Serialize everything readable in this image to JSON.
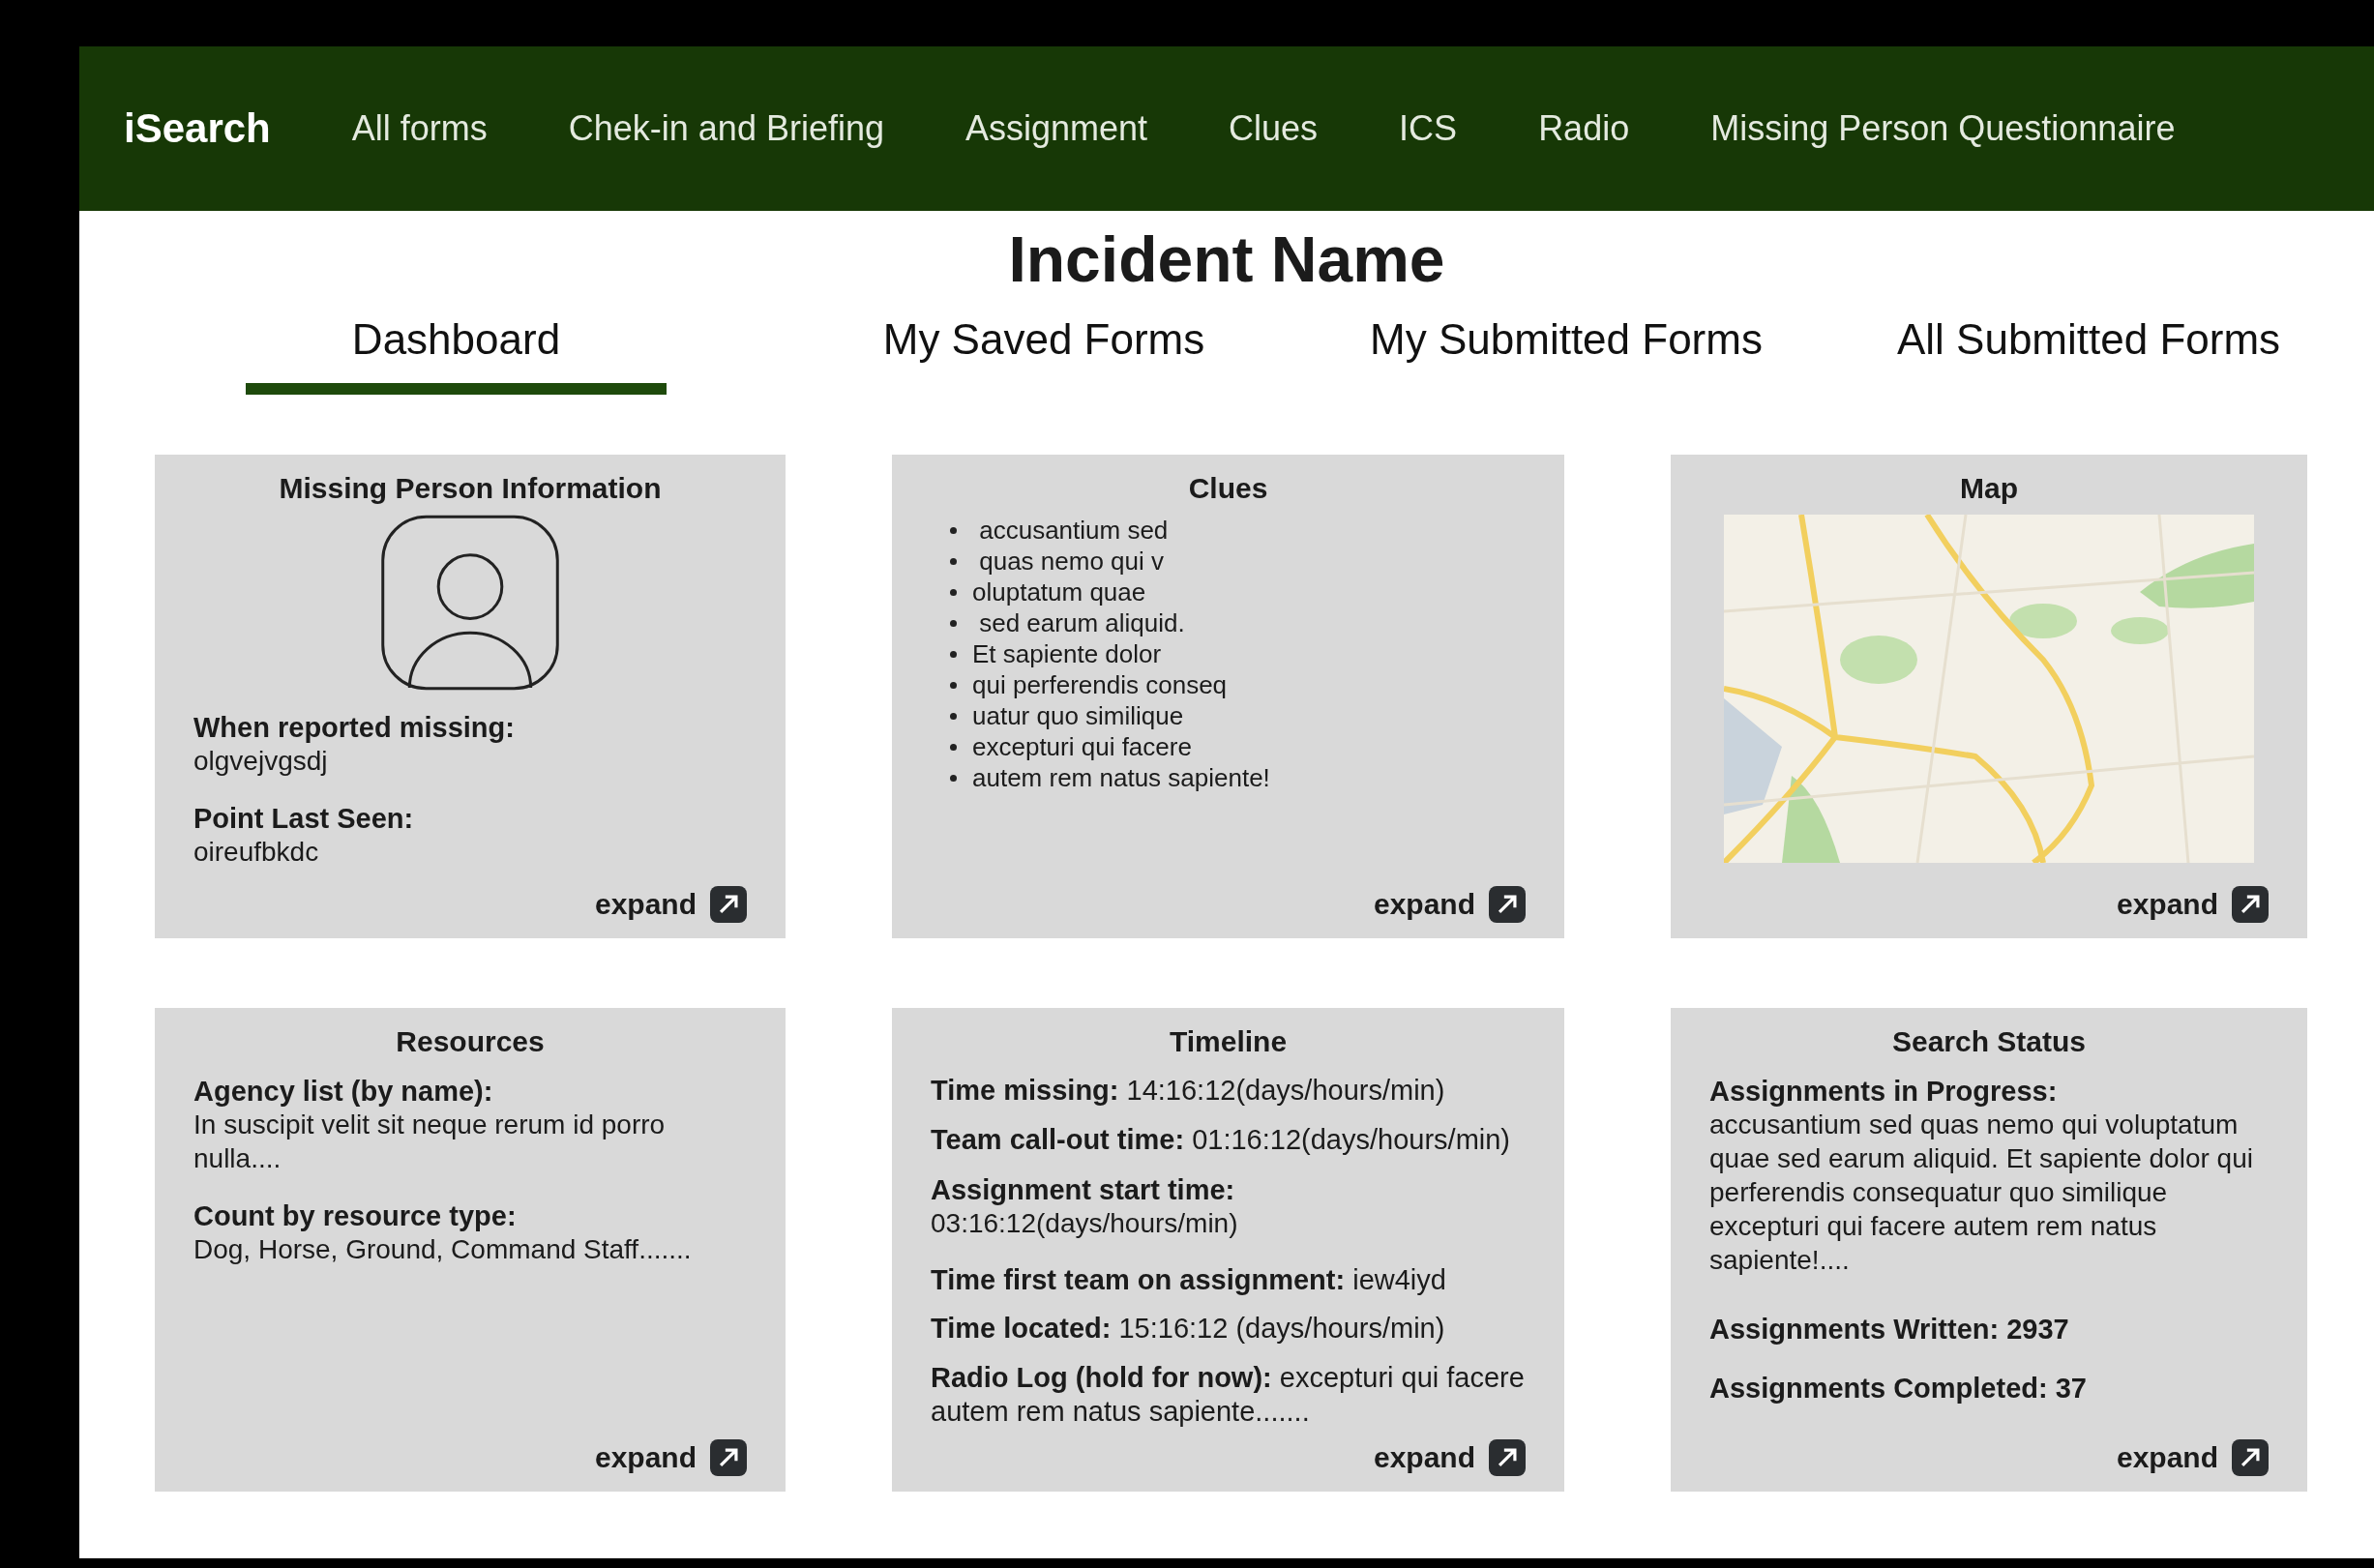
{
  "nav": {
    "brand": "iSearch",
    "items": [
      {
        "label": "All forms"
      },
      {
        "label": "Chek-in and Briefing"
      },
      {
        "label": "Assignment"
      },
      {
        "label": "Clues"
      },
      {
        "label": "ICS"
      },
      {
        "label": "Radio"
      },
      {
        "label": "Missing Person Questionnaire"
      }
    ]
  },
  "title": "Incident Name",
  "tabs": [
    {
      "label": "Dashboard",
      "selected": true
    },
    {
      "label": "My Saved Forms",
      "selected": false
    },
    {
      "label": "My Submitted Forms",
      "selected": false
    },
    {
      "label": "All Submitted Forms",
      "selected": false
    }
  ],
  "cards": [
    {
      "title": "Missing Person Information",
      "expand": "expand",
      "blocks": [
        {
          "kind": "avatar"
        },
        {
          "kind": "stacked",
          "label": "When reported missing:",
          "value": "olgvejvgsdj"
        },
        {
          "kind": "stacked",
          "label": "Point Last Seen:",
          "value": "oireufbkdc"
        }
      ]
    },
    {
      "title": "Clues",
      "expand": "expand",
      "blocks": [
        {
          "kind": "bullets",
          "items": [
            " accusantium sed",
            " quas nemo qui v",
            "oluptatum quae",
            " sed earum aliquid.",
            "Et sapiente dolor",
            "qui perferendis conseq",
            "uatur quo similique",
            "excepturi qui facere",
            "autem rem natus sapiente!"
          ]
        }
      ]
    },
    {
      "title": "Map",
      "expand": "expand"
    },
    {
      "title": "Resources",
      "expand": "expand",
      "blocks": [
        {
          "kind": "stacked",
          "label": "Agency list (by name):",
          "value": "In suscipit velit sit neque rerum id porro nulla...."
        },
        {
          "kind": "stacked",
          "label": "Count by resource type:",
          "value": "Dog, Horse, Ground, Command Staff......."
        }
      ]
    },
    {
      "title": "Timeline",
      "expand": "expand",
      "blocks": [
        {
          "kind": "inline",
          "text": "**Time missing:** 14:16:12(days/hours/min)"
        },
        {
          "kind": "inline",
          "text": "**Team call-out time:** 01:16:12(days/hours/min)"
        },
        {
          "kind": "stacked",
          "label": "Assignment start time:",
          "value": "03:16:12(days/hours/min)"
        },
        {
          "kind": "inline",
          "text": "**Time first team on assignment:** iew4iyd"
        },
        {
          "kind": "inline",
          "text": "**Time located:** 15:16:12 (days/hours/min)"
        },
        {
          "kind": "inline",
          "text": "**Radio Log (hold for now):**  excepturi qui facere autem rem natus sapiente......."
        }
      ]
    },
    {
      "title": "Search Status",
      "expand": "expand",
      "blocks": [
        {
          "kind": "stacked",
          "label": "Assignments in Progress:",
          "value": " accusantium sed quas nemo qui voluptatum quae sed earum aliquid. Et sapiente dolor qui perferendis consequatur quo similique excepturi qui facere autem rem natus sapiente!...."
        },
        {
          "kind": "stat",
          "text": "Assignments Written: 2937"
        },
        {
          "kind": "stat",
          "text": "Assignments Completed: 37"
        }
      ]
    }
  ]
}
